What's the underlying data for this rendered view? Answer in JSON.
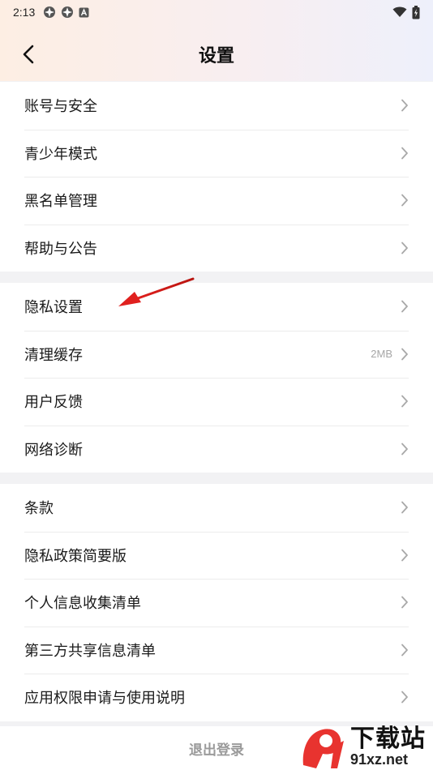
{
  "status_bar": {
    "time": "2:13",
    "left_icons": [
      "app-icon",
      "app-icon",
      "notification-icon"
    ],
    "right_icons": [
      "wifi-icon",
      "battery-icon"
    ]
  },
  "nav": {
    "title": "设置",
    "back_icon": "chevron-left-icon"
  },
  "groups": [
    {
      "items": [
        {
          "label": "账号与安全",
          "value": ""
        },
        {
          "label": "青少年模式",
          "value": ""
        },
        {
          "label": "黑名单管理",
          "value": ""
        },
        {
          "label": "帮助与公告",
          "value": ""
        }
      ]
    },
    {
      "items": [
        {
          "label": "隐私设置",
          "value": ""
        },
        {
          "label": "清理缓存",
          "value": "2MB"
        },
        {
          "label": "用户反馈",
          "value": ""
        },
        {
          "label": "网络诊断",
          "value": ""
        }
      ]
    },
    {
      "items": [
        {
          "label": "条款",
          "value": ""
        },
        {
          "label": "隐私政策简要版",
          "value": ""
        },
        {
          "label": "个人信息收集清单",
          "value": ""
        },
        {
          "label": "第三方共享信息清单",
          "value": ""
        },
        {
          "label": "应用权限申请与使用说明",
          "value": ""
        }
      ]
    }
  ],
  "logout": {
    "label": "退出登录"
  },
  "watermark": {
    "title": "下载站",
    "subtitle": "91xz.net"
  },
  "colors": {
    "accent_arrow": "#e0201e",
    "watermark_red": "#e8332f"
  }
}
